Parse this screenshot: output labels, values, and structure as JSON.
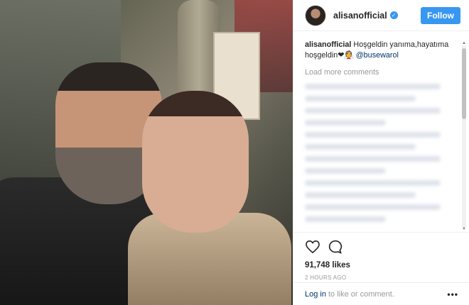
{
  "post": {
    "username": "alisanofficial",
    "follow_label": "Follow",
    "caption_user": "alisanofficial",
    "caption_text": "Hoşgeldin yanıma,hayatıma hoşgeldin❤👰",
    "caption_mention": "@busewarol",
    "load_more": "Load more comments",
    "likes": "91,748 likes",
    "timestamp": "2 HOURS AGO",
    "login_link": "Log in",
    "login_suffix": "to like or comment.",
    "more_icon": "•••"
  },
  "icons": {
    "verified": "verified-badge-icon",
    "like": "heart-icon",
    "comment": "comment-icon",
    "more": "more-options-icon"
  },
  "colors": {
    "accent": "#3897f0",
    "link": "#003569",
    "muted": "#999999"
  }
}
